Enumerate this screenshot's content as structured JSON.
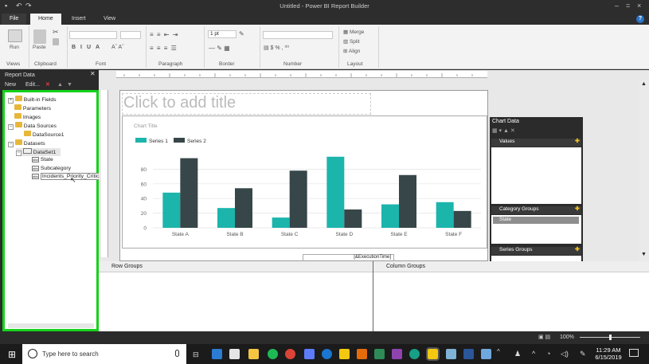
{
  "app": {
    "title": "Untitled - Power BI Report Builder"
  },
  "tabs": [
    {
      "label": "File"
    },
    {
      "label": "Home"
    },
    {
      "label": "Insert"
    },
    {
      "label": "View"
    }
  ],
  "ribbon": {
    "run_label": "Run",
    "paste_label": "Paste",
    "border_width": "1 pt",
    "merge_label": "Merge",
    "split_label": "Split",
    "align_label": "Align",
    "groups": [
      "Views",
      "Clipboard",
      "Font",
      "Paragraph",
      "Border",
      "Number",
      "Layout"
    ]
  },
  "report_data": {
    "title": "Report Data",
    "new_label": "New",
    "edit_label": "Edit...",
    "tree": [
      {
        "label": "Built-in Fields"
      },
      {
        "label": "Parameters"
      },
      {
        "label": "Images"
      },
      {
        "label": "Data Sources"
      },
      {
        "label": "DataSource1"
      },
      {
        "label": "Datasets"
      },
      {
        "label": "DataSet1"
      },
      {
        "label": "State"
      },
      {
        "label": "Subcategory"
      },
      {
        "label": "Incidents_Priority_Critical"
      }
    ]
  },
  "design": {
    "title_placeholder": "Click to add title",
    "execution_time": "[&ExecutionTime]"
  },
  "chart_data": {
    "type": "bar",
    "title": "Chart Title",
    "categories": [
      "State A",
      "State B",
      "State C",
      "State D",
      "State E",
      "State F"
    ],
    "series": [
      {
        "name": "Series 1",
        "color": "#1bb5ac",
        "values": [
          48,
          27,
          14,
          97,
          32,
          35
        ]
      },
      {
        "name": "Series 2",
        "color": "#374649",
        "values": [
          95,
          54,
          78,
          25,
          72,
          23
        ]
      }
    ],
    "ylim": [
      0,
      100
    ],
    "yticks": [
      0,
      20,
      40,
      60,
      80
    ],
    "legend": "top-left",
    "grid": true
  },
  "chart_data_pane": {
    "title": "Chart Data",
    "values_label": "Values",
    "category_groups_label": "Category Groups",
    "category_item": "State",
    "series_groups_label": "Series Groups"
  },
  "groups": {
    "row_label": "Row Groups",
    "column_label": "Column Groups"
  },
  "status": {
    "zoom": "100%"
  },
  "taskbar": {
    "search_placeholder": "Type here to search",
    "time": "11:29 AM",
    "date": "6/15/2019"
  }
}
